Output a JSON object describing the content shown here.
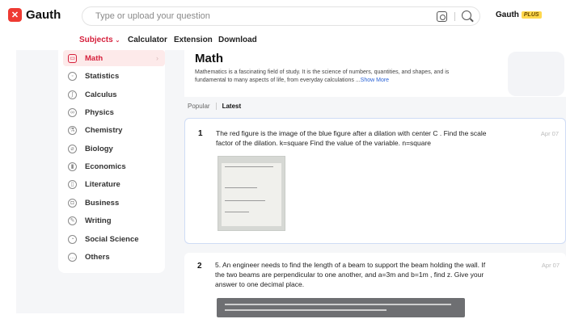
{
  "brand": {
    "name": "Gauth",
    "app_name": "Gauth",
    "plus_label": "PLUS"
  },
  "search": {
    "placeholder": "Type or upload your question"
  },
  "nav": {
    "items": [
      "Subjects",
      "Calculator",
      "Extension",
      "Download"
    ],
    "active": "Subjects"
  },
  "sidebar": {
    "items": [
      {
        "label": "Math",
        "icon": "math-icon",
        "active": true
      },
      {
        "label": "Statistics",
        "icon": "statistics-icon"
      },
      {
        "label": "Calculus",
        "icon": "calculus-icon"
      },
      {
        "label": "Physics",
        "icon": "physics-icon"
      },
      {
        "label": "Chemistry",
        "icon": "chemistry-icon"
      },
      {
        "label": "Biology",
        "icon": "biology-icon"
      },
      {
        "label": "Economics",
        "icon": "economics-icon"
      },
      {
        "label": "Literature",
        "icon": "literature-icon"
      },
      {
        "label": "Business",
        "icon": "business-icon"
      },
      {
        "label": "Writing",
        "icon": "writing-icon"
      },
      {
        "label": "Social Science",
        "icon": "social-science-icon"
      },
      {
        "label": "Others",
        "icon": "others-icon"
      }
    ]
  },
  "topic": {
    "title": "Math",
    "description": "Mathematics is a fascinating field of study. It is the science of numbers, quantities, and shapes, and is fundamental to many aspects of life, from everyday calculations ...",
    "show_more": "Show More"
  },
  "tabs": {
    "popular": "Popular",
    "latest": "Latest"
  },
  "questions": [
    {
      "num": "1",
      "text": "The red figure is the image of the blue figure after a dilation with center C . Find the scale factor of the dilation. k=square Find the value of the variable. n=square",
      "date": "Apr 07"
    },
    {
      "num": "2",
      "text": "5. An engineer needs to find the length of a beam to support the beam holding the wall. If the two beams are perpendicular to one another, and a=3m and b=1m , find z. Give your answer to one decimal place.",
      "date": "Apr 07"
    }
  ],
  "colors": {
    "accent": "#d6203c",
    "logo": "#ee3a32",
    "plus": "#ffd84d",
    "link": "#2a63d6"
  }
}
